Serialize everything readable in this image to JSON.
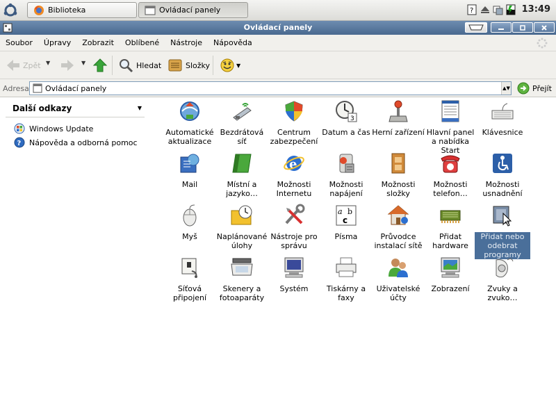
{
  "taskbar": {
    "tasks": [
      {
        "label": "Biblioteka",
        "active": false
      },
      {
        "label": "Ovládací panely",
        "active": true
      }
    ],
    "clock": "13:49"
  },
  "window": {
    "title": "Ovládací panely"
  },
  "menu": [
    "Soubor",
    "Úpravy",
    "Zobrazit",
    "Oblíbené",
    "Nástroje",
    "Nápověda"
  ],
  "toolbar": {
    "back": "Zpět",
    "search": "Hledat",
    "folders": "Složky"
  },
  "address": {
    "label": "Adresa",
    "value": "Ovládací panely",
    "go": "Přejít"
  },
  "sidebar": {
    "heading": "Další odkazy",
    "links": [
      "Windows Update",
      "Nápověda a odborná pomoc"
    ]
  },
  "items": [
    {
      "label": "Automatické aktualizace",
      "icon": "auto-update-icon"
    },
    {
      "label": "Bezdrátová síť",
      "icon": "wireless-icon"
    },
    {
      "label": "Centrum zabezpečení",
      "icon": "security-shield-icon"
    },
    {
      "label": "Datum a čas",
      "icon": "clock-icon"
    },
    {
      "label": "Herní zařízení",
      "icon": "joystick-icon"
    },
    {
      "label": "Hlavní panel a nabídka Start",
      "icon": "taskbar-icon"
    },
    {
      "label": "Klávesnice",
      "icon": "keyboard-icon"
    },
    {
      "label": "Mail",
      "icon": "mail-icon"
    },
    {
      "label": "Místní a jazyko…",
      "icon": "regional-icon"
    },
    {
      "label": "Možnosti Internetu",
      "icon": "internet-icon"
    },
    {
      "label": "Možnosti napájení",
      "icon": "power-icon"
    },
    {
      "label": "Možnosti složky",
      "icon": "folder-options-icon"
    },
    {
      "label": "Možnosti telefon…",
      "icon": "phone-icon"
    },
    {
      "label": "Možnosti usnadnění",
      "icon": "accessibility-icon"
    },
    {
      "label": "Myš",
      "icon": "mouse-icon"
    },
    {
      "label": "Naplánované úlohy",
      "icon": "scheduled-tasks-icon"
    },
    {
      "label": "Nástroje pro správu",
      "icon": "admin-tools-icon"
    },
    {
      "label": "Písma",
      "icon": "fonts-icon"
    },
    {
      "label": "Průvodce instalací sítě",
      "icon": "network-wizard-icon"
    },
    {
      "label": "Přidat hardware",
      "icon": "add-hardware-icon"
    },
    {
      "label": "Přidat nebo odebrat programy",
      "icon": "add-remove-programs-icon",
      "selected": true
    },
    {
      "label": "Síťová připojení",
      "icon": "network-connections-icon"
    },
    {
      "label": "Skenery a fotoaparáty",
      "icon": "scanner-icon"
    },
    {
      "label": "Systém",
      "icon": "system-icon"
    },
    {
      "label": "Tiskárny a faxy",
      "icon": "printer-icon"
    },
    {
      "label": "Uživatelské účty",
      "icon": "user-accounts-icon"
    },
    {
      "label": "Zobrazení",
      "icon": "display-icon"
    },
    {
      "label": "Zvuky a zvuko…",
      "icon": "sound-icon"
    }
  ]
}
